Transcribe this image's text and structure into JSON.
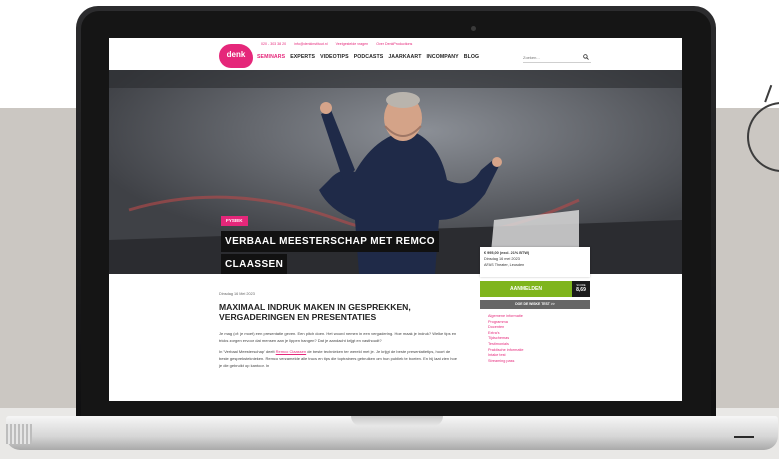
{
  "header": {
    "logo_text": "denk",
    "topline": [
      "020 - 303 38 20",
      "info@denkinstituut.nl",
      "Veelgestelde vragen",
      "Over DenkProductions"
    ],
    "nav": [
      "SEMINARS",
      "EXPERTS",
      "VIDEOTIPS",
      "PODCASTS",
      "JAARKAART",
      "INCOMPANY",
      "BLOG"
    ],
    "active_nav": "SEMINARS",
    "search_placeholder": "Zoeken..."
  },
  "hero": {
    "tag": "FYSIEK",
    "title_line1": "VERBAAL MEESTERSCHAP MET REMCO",
    "title_line2": "CLAASSEN"
  },
  "event": {
    "price": "€ 995,00 (excl. 21% BTW)",
    "date": "Dinsdag 16 mei 2023",
    "venue": "AFAS Theater, Leusden",
    "register_label": "AANMELDEN",
    "score_label": "SCORE",
    "score_value": "8,69",
    "test_label": "DOE DE WISKE TEST >>"
  },
  "side_menu": [
    "Algemene informatie",
    "Programma",
    "Docenten",
    "Extra's",
    "Tijdschemas",
    "Testimonials",
    "Praktische informatie",
    "Intake test",
    "Streaming pass"
  ],
  "article": {
    "date": "Dinsdag 16 Mei 2023",
    "headline": "MAXIMAAL INDRUK MAKEN IN GESPREKKEN, VERGADERINGEN EN PRESENTATIES",
    "para1": "Je mag (of: je moet) een presentatie geven. Een pitch doen. Het woord nemen in een vergadering. Hoe maak je indruk? Welke tips en tricks zorgen ervoor dat mensen aan je lippen hangen? Dat je aandacht krijgt en vasthoudt?",
    "para2_before": "In 'Verbaal Meesterschap' deelt ",
    "para2_link": "Remco Claassen",
    "para2_after": " de beste technieken ter wereld met je. Je krijgt de beste presentatietips, hoort de beste gespreksteknieken. Remco verzamelde alle trucs en tips die toptrainers gebruiken om hun publiek te boeien. En hij laat zien hoe je die gebruikt op kantoor. In"
  },
  "colors": {
    "brand_pink": "#e5277a",
    "register_green": "#7fb51d",
    "wall": "#cbc7c2"
  }
}
